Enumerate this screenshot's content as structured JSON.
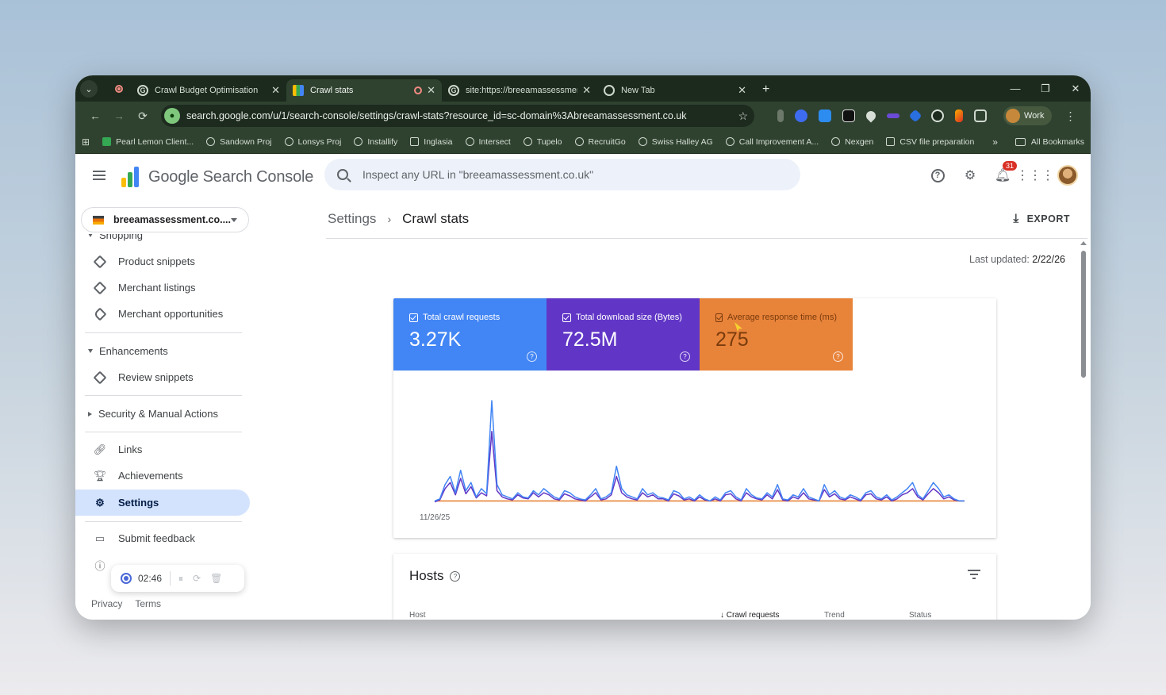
{
  "browser": {
    "tabs": [
      {
        "title": "Crawl Budget Optimisation",
        "active": false
      },
      {
        "title": "Crawl stats",
        "active": true
      },
      {
        "title": "site:https://breeamassessment.c",
        "active": false
      },
      {
        "title": "New Tab",
        "active": false
      }
    ],
    "url": "search.google.com/u/1/search-console/settings/crawl-stats?resource_id=sc-domain%3Abreeamassessment.co.uk",
    "profile": "Work",
    "bookmarks": [
      "Pearl Lemon Client...",
      "Sandown Proj",
      "Lonsys Proj",
      "Installify",
      "Inglasia",
      "Intersect",
      "Tupelo",
      "RecruitGo",
      "Swiss Halley AG",
      "Call Improvement A...",
      "Nexgen",
      "CSV file preparation"
    ],
    "all_bookmarks": "All Bookmarks",
    "icons": {
      "back": "←",
      "forward": "→",
      "reload": "⟳",
      "star": "☆",
      "more": "⋮",
      "close": "✕",
      "newtab": "+",
      "minimize": "—",
      "restore": "❐",
      "chevron": "»"
    }
  },
  "gsc": {
    "logo_text": "Google Search Console",
    "search_placeholder": "Inspect any URL in \"breeamassessment.co.uk\"",
    "notification_count": "31",
    "property": "breeamassessment.co....",
    "sidebar": {
      "section_shopping": "Shopping",
      "items": [
        "Product snippets",
        "Merchant listings",
        "Merchant opportunities"
      ],
      "section_enhancements": "Enhancements",
      "enh_items": [
        "Review snippets"
      ],
      "section_security": "Security & Manual Actions",
      "links": "Links",
      "achievements": "Achievements",
      "settings": "Settings",
      "submit_feedback": "Submit feedback",
      "about": "About Search Console"
    },
    "recorder_time": "02:46",
    "footer": {
      "privacy": "Privacy",
      "terms": "Terms"
    },
    "breadcrumb": {
      "parent": "Settings",
      "sep": "›",
      "current": "Crawl stats"
    },
    "export_label": "EXPORT",
    "last_updated_label": "Last updated:",
    "last_updated_value": "2/22/26",
    "metrics": [
      {
        "label": "Total crawl requests",
        "value": "3.27K"
      },
      {
        "label": "Total download size (Bytes)",
        "value": "72.5M"
      },
      {
        "label": "Average response time (ms)",
        "value": "275"
      }
    ],
    "hosts": {
      "title": "Hosts",
      "columns": [
        "Host",
        "Crawl requests",
        "Trend",
        "Status"
      ]
    }
  },
  "chart_data": {
    "type": "line",
    "x_start_label": "11/26/25",
    "series": [
      {
        "name": "Total crawl requests",
        "color": "#4285f4",
        "values": [
          2,
          4,
          18,
          26,
          10,
          32,
          12,
          20,
          6,
          14,
          9,
          100,
          18,
          8,
          6,
          4,
          10,
          6,
          5,
          12,
          8,
          14,
          10,
          6,
          4,
          12,
          10,
          6,
          4,
          3,
          8,
          14,
          4,
          6,
          10,
          36,
          14,
          8,
          6,
          4,
          14,
          8,
          10,
          6,
          5,
          3,
          12,
          10,
          4,
          6,
          3,
          8,
          4,
          2,
          6,
          3,
          10,
          12,
          6,
          3,
          14,
          8,
          5,
          4,
          10,
          6,
          18,
          4,
          3,
          8,
          6,
          14,
          6,
          4,
          2,
          18,
          8,
          12,
          6,
          4,
          8,
          6,
          3,
          10,
          12,
          6,
          4,
          8,
          3,
          6,
          10,
          14,
          20,
          8,
          4,
          12,
          20,
          14,
          6,
          8,
          4,
          2,
          2
        ]
      },
      {
        "name": "Total download size (Bytes)",
        "color": "#6136c6",
        "values": [
          1,
          3,
          14,
          20,
          8,
          24,
          9,
          16,
          5,
          10,
          7,
          70,
          12,
          6,
          4,
          3,
          8,
          5,
          4,
          10,
          6,
          10,
          8,
          4,
          3,
          9,
          7,
          4,
          3,
          2,
          6,
          10,
          3,
          4,
          8,
          26,
          10,
          6,
          4,
          3,
          10,
          6,
          8,
          4,
          4,
          2,
          9,
          7,
          3,
          4,
          2,
          6,
          3,
          2,
          4,
          2,
          8,
          9,
          4,
          2,
          10,
          6,
          4,
          3,
          8,
          4,
          13,
          3,
          2,
          6,
          4,
          10,
          4,
          3,
          2,
          13,
          6,
          9,
          4,
          3,
          6,
          4,
          2,
          8,
          9,
          4,
          3,
          6,
          2,
          4,
          8,
          10,
          14,
          6,
          3,
          9,
          14,
          10,
          4,
          6,
          3,
          2,
          2
        ]
      },
      {
        "name": "Average response time (ms)",
        "color": "#e8833a",
        "values": [
          2,
          2,
          2,
          2,
          2,
          2,
          2,
          2,
          2,
          2,
          2,
          2,
          2,
          2,
          2,
          2,
          2,
          2,
          2,
          2,
          2,
          2,
          2,
          2,
          2,
          2,
          2,
          2,
          2,
          2,
          2,
          2,
          2,
          2,
          2,
          2,
          2,
          2,
          2,
          2,
          2,
          2,
          2,
          2,
          2,
          2,
          2,
          2,
          2,
          2,
          2,
          2,
          2,
          2,
          2,
          2,
          2,
          2,
          2,
          2,
          2,
          2,
          2,
          2,
          2,
          2,
          2,
          2,
          2,
          2,
          2,
          2,
          2,
          2,
          2,
          2,
          2,
          2,
          2,
          2,
          2,
          2,
          2,
          2,
          2,
          2,
          2,
          2,
          2,
          2,
          2,
          2,
          2,
          2,
          2,
          2,
          2,
          2,
          2,
          2,
          2,
          2,
          2
        ]
      }
    ],
    "grid": false,
    "legend": "top"
  }
}
